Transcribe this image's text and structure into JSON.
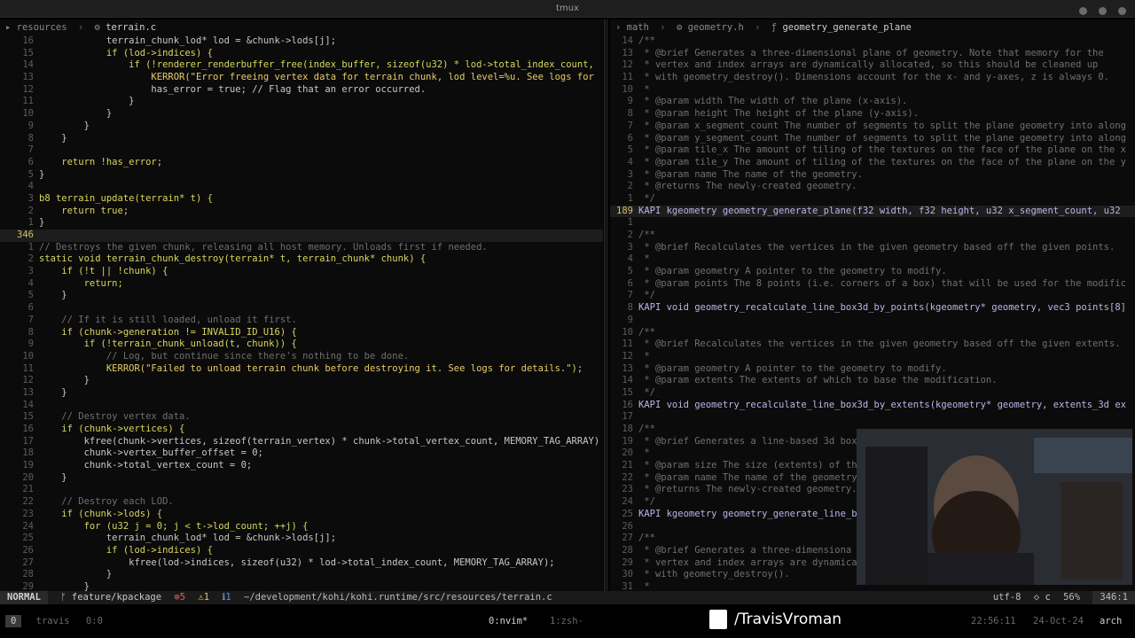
{
  "window": {
    "title": "tmux"
  },
  "left": {
    "breadcrumb": [
      {
        "icon": "folder-icon",
        "text": "resources"
      },
      {
        "icon": "c-file-icon",
        "text": "terrain.c"
      }
    ],
    "lines": [
      {
        "n": "16",
        "t": "            terrain_chunk_lod* lod = &chunk->lods[j];"
      },
      {
        "n": "15",
        "t": "            if (lod->indices) {"
      },
      {
        "n": "14",
        "t": "                if (!renderer_renderbuffer_free(index_buffer, sizeof(u32) * lod->total_index_count,"
      },
      {
        "n": "13",
        "t": "                    KERROR(\"Error freeing vertex data for terrain chunk, lod level=%u. See logs for"
      },
      {
        "n": "12",
        "t": "                    has_error = true; // Flag that an error occurred."
      },
      {
        "n": "11",
        "t": "                }"
      },
      {
        "n": "10",
        "t": "            }"
      },
      {
        "n": "9",
        "t": "        }"
      },
      {
        "n": "8",
        "t": "    }"
      },
      {
        "n": "7",
        "t": ""
      },
      {
        "n": "6",
        "t": "    return !has_error;"
      },
      {
        "n": "5",
        "t": "}"
      },
      {
        "n": "4",
        "t": ""
      },
      {
        "n": "3",
        "t": "b8 terrain_update(terrain* t) {"
      },
      {
        "n": "2",
        "t": "    return true;"
      },
      {
        "n": "1",
        "t": "}"
      },
      {
        "n": "346",
        "t": "",
        "cur": true
      },
      {
        "n": "1",
        "t": "// Destroys the given chunk, releasing all host memory. Unloads first if needed."
      },
      {
        "n": "2",
        "t": "static void terrain_chunk_destroy(terrain* t, terrain_chunk* chunk) {"
      },
      {
        "n": "3",
        "t": "    if (!t || !chunk) {"
      },
      {
        "n": "4",
        "t": "        return;"
      },
      {
        "n": "5",
        "t": "    }"
      },
      {
        "n": "6",
        "t": ""
      },
      {
        "n": "7",
        "t": "    // If it is still loaded, unload it first."
      },
      {
        "n": "8",
        "t": "    if (chunk->generation != INVALID_ID_U16) {"
      },
      {
        "n": "9",
        "t": "        if (!terrain_chunk_unload(t, chunk)) {"
      },
      {
        "n": "10",
        "t": "            // Log, but continue since there's nothing to be done."
      },
      {
        "n": "11",
        "t": "            KERROR(\"Failed to unload terrain chunk before destroying it. See logs for details.\");"
      },
      {
        "n": "12",
        "t": "        }"
      },
      {
        "n": "13",
        "t": "    }"
      },
      {
        "n": "14",
        "t": ""
      },
      {
        "n": "15",
        "t": "    // Destroy vertex data."
      },
      {
        "n": "16",
        "t": "    if (chunk->vertices) {"
      },
      {
        "n": "17",
        "t": "        kfree(chunk->vertices, sizeof(terrain_vertex) * chunk->total_vertex_count, MEMORY_TAG_ARRAY)"
      },
      {
        "n": "18",
        "t": "        chunk->vertex_buffer_offset = 0;"
      },
      {
        "n": "19",
        "t": "        chunk->total_vertex_count = 0;"
      },
      {
        "n": "20",
        "t": "    }"
      },
      {
        "n": "21",
        "t": ""
      },
      {
        "n": "22",
        "t": "    // Destroy each LOD."
      },
      {
        "n": "23",
        "t": "    if (chunk->lods) {"
      },
      {
        "n": "24",
        "t": "        for (u32 j = 0; j < t->lod_count; ++j) {"
      },
      {
        "n": "25",
        "t": "            terrain_chunk_lod* lod = &chunk->lods[j];"
      },
      {
        "n": "26",
        "t": "            if (lod->indices) {"
      },
      {
        "n": "27",
        "t": "                kfree(lod->indices, sizeof(u32) * lod->total_index_count, MEMORY_TAG_ARRAY);"
      },
      {
        "n": "28",
        "t": "            }"
      },
      {
        "n": "29",
        "t": "        }"
      }
    ]
  },
  "right": {
    "breadcrumb": [
      {
        "icon": "folder-icon",
        "text": "math"
      },
      {
        "icon": "h-file-icon",
        "text": "geometry.h"
      },
      {
        "icon": "function-icon",
        "text": "geometry_generate_plane"
      }
    ],
    "lines": [
      {
        "n": "14",
        "t": "/**"
      },
      {
        "n": "13",
        "t": " * @brief Generates a three-dimensional plane of geometry. Note that memory for the"
      },
      {
        "n": "12",
        "t": " * vertex and index arrays are dynamically allocated, so this should be cleaned up"
      },
      {
        "n": "11",
        "t": " * with geometry_destroy(). Dimensions account for the x- and y-axes, z is always 0."
      },
      {
        "n": "10",
        "t": " *"
      },
      {
        "n": "9",
        "t": " * @param width The width of the plane (x-axis)."
      },
      {
        "n": "8",
        "t": " * @param height The height of the plane (y-axis)."
      },
      {
        "n": "7",
        "t": " * @param x_segment_count The number of segments to split the plane geometry into along"
      },
      {
        "n": "6",
        "t": " * @param y_segment_count The number of segments to split the plane geometry into along"
      },
      {
        "n": "5",
        "t": " * @param tile_x The amount of tiling of the textures on the face of the plane on the x"
      },
      {
        "n": "4",
        "t": " * @param tile_y The amount of tiling of the textures on the face of the plane on the y"
      },
      {
        "n": "3",
        "t": " * @param name The name of the geometry."
      },
      {
        "n": "2",
        "t": " * @returns The newly-created geometry."
      },
      {
        "n": "1",
        "t": " */"
      },
      {
        "n": "189",
        "t": "KAPI kgeometry geometry_generate_plane(f32 width, f32 height, u32 x_segment_count, u32",
        "cur": true
      },
      {
        "n": "1",
        "t": ""
      },
      {
        "n": "2",
        "t": "/**"
      },
      {
        "n": "3",
        "t": " * @brief Recalculates the vertices in the given geometry based off the given points."
      },
      {
        "n": "4",
        "t": " *"
      },
      {
        "n": "5",
        "t": " * @param geometry A pointer to the geometry to modify."
      },
      {
        "n": "6",
        "t": " * @param points The 8 points (i.e. corners of a box) that will be used for the modific"
      },
      {
        "n": "7",
        "t": " */"
      },
      {
        "n": "8",
        "t": "KAPI void geometry_recalculate_line_box3d_by_points(kgeometry* geometry, vec3 points[8]"
      },
      {
        "n": "9",
        "t": ""
      },
      {
        "n": "10",
        "t": "/**"
      },
      {
        "n": "11",
        "t": " * @brief Recalculates the vertices in the given geometry based off the given extents."
      },
      {
        "n": "12",
        "t": " *"
      },
      {
        "n": "13",
        "t": " * @param geometry A pointer to the geometry to modify."
      },
      {
        "n": "14",
        "t": " * @param extents The extents of which to base the modification."
      },
      {
        "n": "15",
        "t": " */"
      },
      {
        "n": "16",
        "t": "KAPI void geometry_recalculate_line_box3d_by_extents(kgeometry* geometry, extents_3d ex"
      },
      {
        "n": "17",
        "t": ""
      },
      {
        "n": "18",
        "t": "/**"
      },
      {
        "n": "19",
        "t": " * @brief Generates a line-based 3d box"
      },
      {
        "n": "20",
        "t": " *"
      },
      {
        "n": "21",
        "t": " * @param size The size (extents) of th"
      },
      {
        "n": "22",
        "t": " * @param name The name of the geometry"
      },
      {
        "n": "23",
        "t": " * @returns The newly-created geometry."
      },
      {
        "n": "24",
        "t": " */"
      },
      {
        "n": "25",
        "t": "KAPI kgeometry geometry_generate_line_b"
      },
      {
        "n": "26",
        "t": ""
      },
      {
        "n": "27",
        "t": "/**"
      },
      {
        "n": "28",
        "t": " * @brief Generates a three-dimensiona"
      },
      {
        "n": "29",
        "t": " * vertex and index arrays are dynamica"
      },
      {
        "n": "30",
        "t": " * with geometry_destroy()."
      },
      {
        "n": "31",
        "t": " *"
      }
    ]
  },
  "status": {
    "mode": "NORMAL",
    "branch": "feature/kpackage",
    "errors": "5",
    "warnings": "1",
    "info": "1",
    "path": "~/development/kohi/kohi.runtime/src/resources/terrain.c",
    "encoding": "utf-8",
    "filetype": "c",
    "percent": "56%",
    "position": "346:1"
  },
  "tmux": {
    "session_index": "0",
    "user": "travis",
    "pane": "0:0",
    "win1": "0:nvim*",
    "win2": "1:zsh-",
    "time": "22:56:11",
    "date": "24-Oct-24",
    "os": "arch"
  },
  "overlay": {
    "twitch_handle": "/TravisVroman"
  },
  "colors": {
    "background": "#0b0b0b",
    "keyword": "#d7d760",
    "comment": "#6f6f6f",
    "function": "#b7b7e8"
  }
}
